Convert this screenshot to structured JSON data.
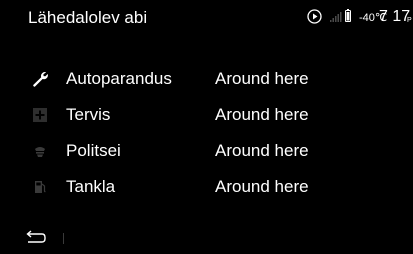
{
  "header": {
    "title": "Lähedalolev abi",
    "temperature": "-40℃",
    "time": "7 17",
    "ampm": "P",
    "icons": [
      "play-circle-icon",
      "signal-bars-icon",
      "battery-icon"
    ]
  },
  "list": {
    "items": [
      {
        "label": "Autoparandus",
        "value": "Around here",
        "icon": "wrench-icon",
        "enabled": true
      },
      {
        "label": "Tervis",
        "value": "Around here",
        "icon": "medical-cross-icon",
        "enabled": false
      },
      {
        "label": "Politsei",
        "value": "Around here",
        "icon": "police-icon",
        "enabled": false
      },
      {
        "label": "Tankla",
        "value": "Around here",
        "icon": "fuel-pump-icon",
        "enabled": false
      }
    ]
  },
  "footer": {
    "back_icon": "back-arrow-icon"
  },
  "colors": {
    "background": "#000000",
    "text": "#ffffff",
    "icon_active": "#ffffff",
    "icon_dim": "#3c3c3c"
  }
}
